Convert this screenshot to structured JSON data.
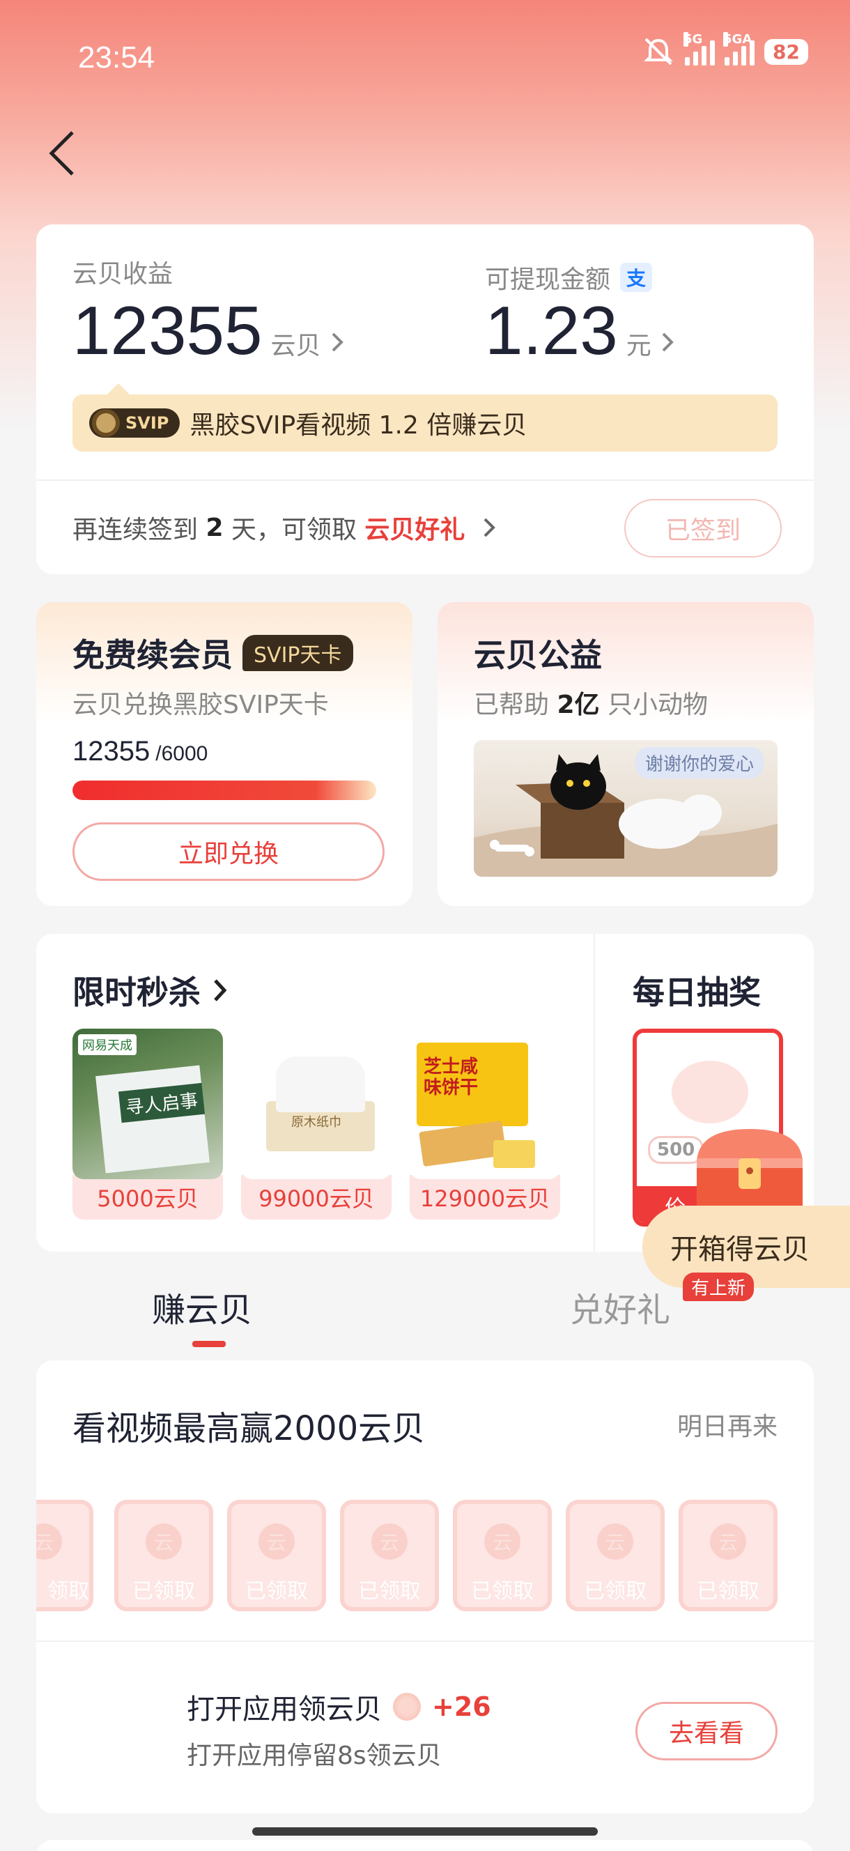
{
  "status_bar": {
    "time": "23:54",
    "net1": "5G",
    "net2": "5GA",
    "battery": "82"
  },
  "earnings": {
    "yunbei_label": "云贝收益",
    "yunbei_value": "12355",
    "yunbei_unit": "云贝",
    "withdraw_label": "可提现金额",
    "withdraw_value": "1.23",
    "withdraw_unit": "元",
    "alipay_glyph": "支",
    "svip_badge": "SVIP",
    "svip_promo": "黑胶SVIP看视频 1.2 倍赚云贝",
    "checkin_prefix": "再连续签到 ",
    "checkin_days": "2",
    "checkin_mid": " 天，可领取 ",
    "checkin_reward": "云贝好礼",
    "checkin_button": "已签到"
  },
  "renew": {
    "title": "免费续会员",
    "tag": "SVIP天卡",
    "subtitle": "云贝兑换黑胶SVIP天卡",
    "current": "12355",
    "target": "/6000",
    "progress": 1.0,
    "button": "立即兑换"
  },
  "welfare": {
    "title": "云贝公益",
    "sub_prefix": "已帮助 ",
    "sub_count": "2亿",
    "sub_suffix": " 只小动物",
    "bubble": "谢谢你的爱心"
  },
  "flash_sale": {
    "title": "限时秒杀",
    "products": [
      {
        "price": "5000云贝",
        "img_text": "寻人启事",
        "brand": "网易天成"
      },
      {
        "price": "99000云贝",
        "img_text": "原木纸巾"
      },
      {
        "price": "129000云贝",
        "img_text": "芝士咸味饼干"
      }
    ]
  },
  "lottery": {
    "title": "每日抽奖",
    "coin_value": "500",
    "price_frag": "价",
    "open_box": "开箱得云贝"
  },
  "tabs": {
    "earn": "赚云贝",
    "redeem": "兑好礼",
    "redeem_badge": "有上新"
  },
  "video_task": {
    "title": "看视频最高赢2000云贝",
    "status": "明日再来",
    "coin_label": "已领取",
    "partial_label": "领取",
    "coin_glyph": "云"
  },
  "app_task": {
    "title": "打开应用领云贝",
    "reward": "+26",
    "desc": "打开应用停留8s领云贝",
    "button": "去看看"
  }
}
